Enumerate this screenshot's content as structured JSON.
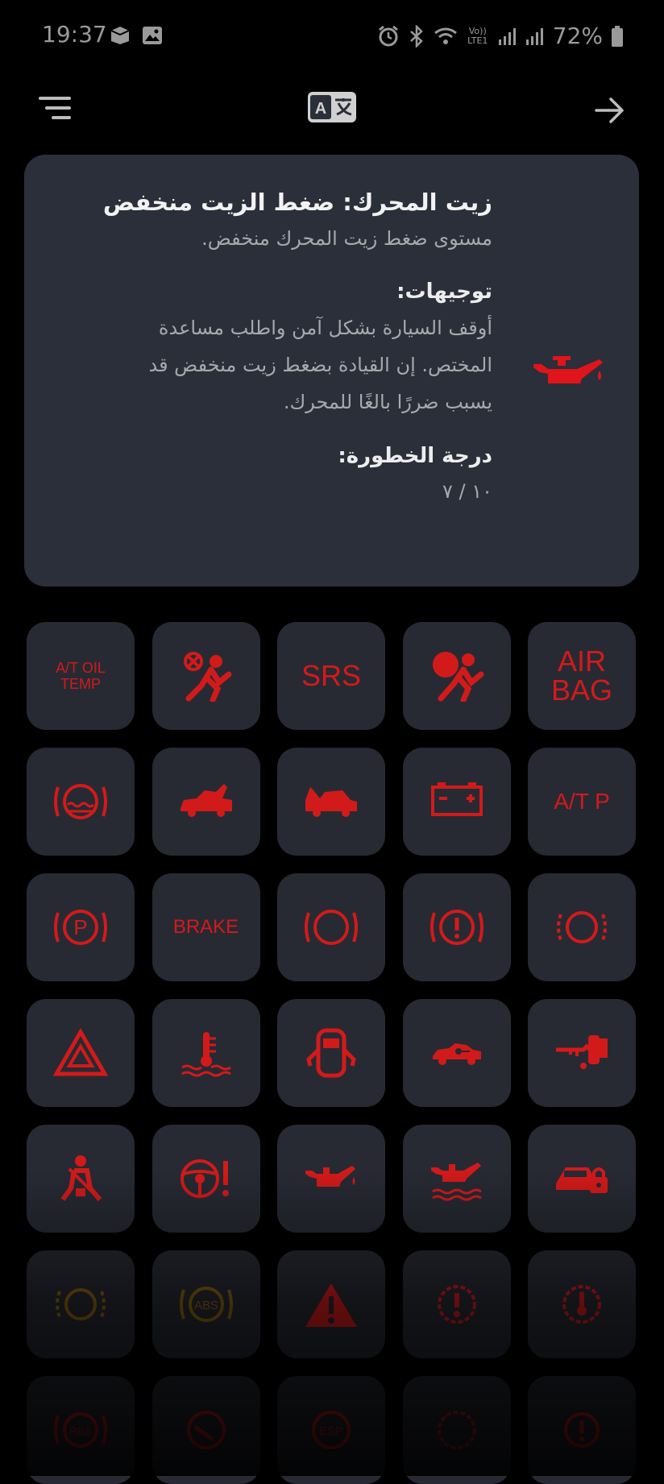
{
  "status_bar": {
    "time": "19:37",
    "network_label": "Vo)) LTE1",
    "battery": "72%"
  },
  "detail": {
    "title": "زيت المحرك: ضغط الزيت منخفض",
    "description": "مستوى ضغط زيت المحرك منخفض.",
    "guidance_heading": "توجيهات:",
    "guidance_lines": [
      "أوقف السيارة بشكل آمن واطلب مساعدة",
      "المختص. إن القيادة بضغط زيت منخفض قد",
      "يسبب ضررًا بالغًا للمحرك."
    ],
    "severity_heading": "درجة الخطورة:",
    "severity_value": "١٠ / ٧",
    "icon": "oil-can-icon",
    "icon_color": "#e0141b"
  },
  "colors": {
    "red": "#d31a1a",
    "amber": "#8a6410",
    "card": "#2b2f39",
    "tile": "#272a33"
  },
  "grid": [
    {
      "type": "text",
      "label": "A/T OIL\nTEMP",
      "name": "at-oil-temp"
    },
    {
      "type": "icon",
      "icon": "airbag-off-icon",
      "name": "airbag-off"
    },
    {
      "type": "text",
      "label": "SRS",
      "name": "srs"
    },
    {
      "type": "icon",
      "icon": "airbag-icon",
      "name": "airbag"
    },
    {
      "type": "text",
      "label": "AIR\nBAG",
      "name": "air-bag"
    },
    {
      "type": "icon",
      "icon": "brake-fluid-level-icon",
      "name": "brake-fluid"
    },
    {
      "type": "icon",
      "icon": "trunk-open-icon",
      "name": "trunk-open"
    },
    {
      "type": "icon",
      "icon": "hood-open-icon",
      "name": "hood-open"
    },
    {
      "type": "icon",
      "icon": "battery-icon",
      "name": "battery"
    },
    {
      "type": "text",
      "label": "A/T P",
      "name": "at-p"
    },
    {
      "type": "icon",
      "icon": "parking-brake-icon",
      "name": "parking-brake"
    },
    {
      "type": "text",
      "label": "BRAKE",
      "name": "brake"
    },
    {
      "type": "icon",
      "icon": "brake-circle-icon",
      "name": "brake-circle"
    },
    {
      "type": "icon",
      "icon": "brake-warning-icon",
      "name": "brake-warning"
    },
    {
      "type": "icon",
      "icon": "brake-pad-wear-icon",
      "name": "brake-pad"
    },
    {
      "type": "icon",
      "icon": "hazard-icon",
      "name": "hazard"
    },
    {
      "type": "icon",
      "icon": "coolant-temp-icon",
      "name": "coolant-temp"
    },
    {
      "type": "icon",
      "icon": "door-open-icon",
      "name": "door-open"
    },
    {
      "type": "icon",
      "icon": "car-key-icon",
      "name": "car-key"
    },
    {
      "type": "icon",
      "icon": "immobilizer-key-icon",
      "name": "immobilizer"
    },
    {
      "type": "icon",
      "icon": "seatbelt-icon",
      "name": "seatbelt"
    },
    {
      "type": "icon",
      "icon": "steering-warning-icon",
      "name": "steering"
    },
    {
      "type": "icon",
      "icon": "oil-can-icon",
      "name": "oil-pressure"
    },
    {
      "type": "icon",
      "icon": "oil-level-icon",
      "name": "oil-level"
    },
    {
      "type": "icon",
      "icon": "car-lock-icon",
      "name": "car-lock"
    },
    {
      "type": "icon",
      "icon": "brake-pad-amber-icon",
      "name": "brake-pad-amber"
    },
    {
      "type": "icon",
      "icon": "abs-icon",
      "name": "abs",
      "label": "ABS"
    },
    {
      "type": "icon",
      "icon": "warning-triangle-icon",
      "name": "warning-triangle"
    },
    {
      "type": "icon",
      "icon": "tpms-warning-icon",
      "name": "tpms-warning"
    },
    {
      "type": "icon",
      "icon": "transmission-temp-icon",
      "name": "transmission-temp"
    },
    {
      "type": "icon",
      "icon": "rbs-icon",
      "name": "rbs",
      "label": "RBS"
    },
    {
      "type": "icon",
      "icon": "steering-lock-icon",
      "name": "steering-lock"
    },
    {
      "type": "icon",
      "icon": "esp-icon",
      "name": "esp",
      "label": "ESP"
    },
    {
      "type": "icon",
      "icon": "gear-warning-icon",
      "name": "gear-warning"
    },
    {
      "type": "icon",
      "icon": "brake-warning-2-icon",
      "name": "brake-warning-2"
    }
  ]
}
